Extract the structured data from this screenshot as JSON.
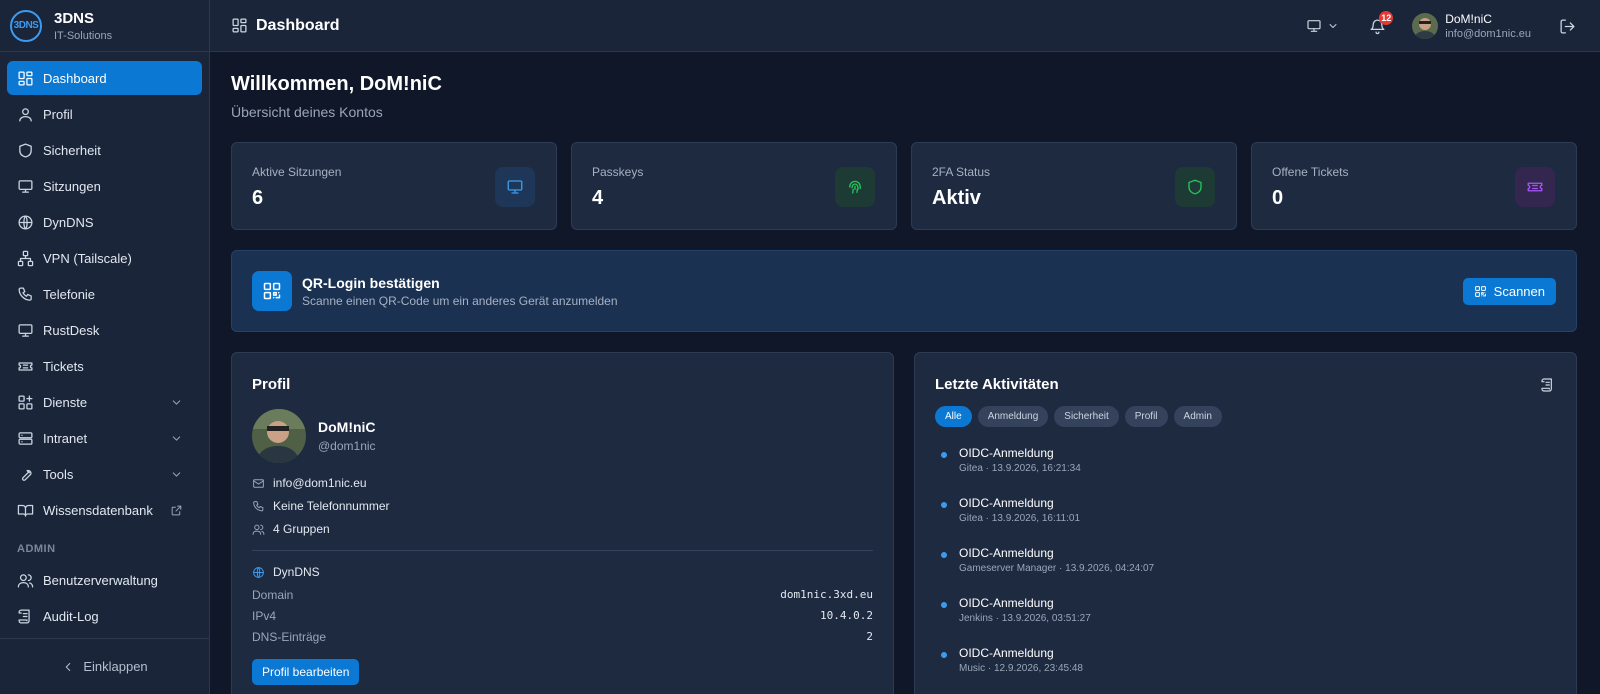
{
  "brand": {
    "logo_text": "3DNS",
    "name": "3DNS",
    "subtitle": "IT-Solutions"
  },
  "sidebar": {
    "items": [
      {
        "label": "Dashboard",
        "icon": "dashboard-icon",
        "active": true
      },
      {
        "label": "Profil",
        "icon": "user-icon"
      },
      {
        "label": "Sicherheit",
        "icon": "shield-icon"
      },
      {
        "label": "Sitzungen",
        "icon": "monitor-icon"
      },
      {
        "label": "DynDNS",
        "icon": "globe-icon"
      },
      {
        "label": "VPN (Tailscale)",
        "icon": "network-icon"
      },
      {
        "label": "Telefonie",
        "icon": "phone-icon"
      },
      {
        "label": "RustDesk",
        "icon": "monitor-icon"
      },
      {
        "label": "Tickets",
        "icon": "ticket-icon"
      },
      {
        "label": "Dienste",
        "icon": "grid-plus-icon",
        "expandable": true
      },
      {
        "label": "Intranet",
        "icon": "server-icon",
        "expandable": true
      },
      {
        "label": "Tools",
        "icon": "wrench-icon",
        "expandable": true
      },
      {
        "label": "Wissensdatenbank",
        "icon": "book-icon",
        "external": true
      }
    ],
    "admin_section": "ADMIN",
    "admin_items": [
      {
        "label": "Benutzerverwaltung",
        "icon": "users-icon"
      },
      {
        "label": "Audit-Log",
        "icon": "log-icon"
      }
    ],
    "collapse_label": "Einklappen"
  },
  "topbar": {
    "title": "Dashboard",
    "notification_count": "12",
    "user_name": "DoM!niC",
    "user_email": "info@dom1nic.eu"
  },
  "main": {
    "welcome": "Willkommen, DoM!niC",
    "subtitle": "Übersicht deines Kontos"
  },
  "stats": [
    {
      "label": "Aktive Sitzungen",
      "value": "6",
      "icon": "monitor-icon",
      "color": "#3b9bf0",
      "bg": "#1e3657"
    },
    {
      "label": "Passkeys",
      "value": "4",
      "icon": "fingerprint-icon",
      "color": "#22c55e",
      "bg": "#1d3a34"
    },
    {
      "label": "2FA Status",
      "value": "Aktiv",
      "icon": "shield-icon",
      "color": "#22c55e",
      "bg": "#1d3a34"
    },
    {
      "label": "Offene Tickets",
      "value": "0",
      "icon": "ticket-icon",
      "color": "#a855f7",
      "bg": "#33264f"
    }
  ],
  "qr": {
    "title": "QR-Login bestätigen",
    "subtitle": "Scanne einen QR-Code um ein anderes Gerät anzumelden",
    "button": "Scannen"
  },
  "profile": {
    "title": "Profil",
    "name": "DoM!niC",
    "handle": "@dom1nic",
    "email": "info@dom1nic.eu",
    "phone": "Keine Telefonnummer",
    "groups": "4 Gruppen",
    "dyndns_title": "DynDNS",
    "fields": [
      {
        "key": "Domain",
        "value": "dom1nic.3xd.eu"
      },
      {
        "key": "IPv4",
        "value": "10.4.0.2"
      },
      {
        "key": "DNS-Einträge",
        "value": "2"
      }
    ],
    "edit_button": "Profil bearbeiten"
  },
  "activity": {
    "title": "Letzte Aktivitäten",
    "filters": [
      "Alle",
      "Anmeldung",
      "Sicherheit",
      "Profil",
      "Admin"
    ],
    "active_filter": "Alle",
    "items": [
      {
        "title": "OIDC-Anmeldung",
        "meta": "Gitea · 13.9.2026, 16:21:34"
      },
      {
        "title": "OIDC-Anmeldung",
        "meta": "Gitea · 13.9.2026, 16:11:01"
      },
      {
        "title": "OIDC-Anmeldung",
        "meta": "Gameserver Manager · 13.9.2026, 04:24:07"
      },
      {
        "title": "OIDC-Anmeldung",
        "meta": "Jenkins · 13.9.2026, 03:51:27"
      },
      {
        "title": "OIDC-Anmeldung",
        "meta": "Music · 12.9.2026, 23:45:48"
      }
    ]
  },
  "colors": {
    "accent": "#0b78d4",
    "background": "#0f1729",
    "panel": "#1e2a40"
  }
}
